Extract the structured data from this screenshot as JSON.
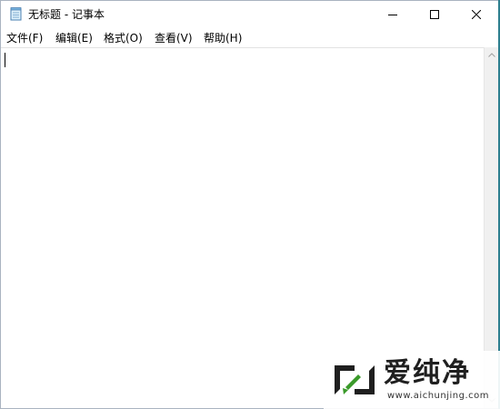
{
  "window": {
    "title": "无标题 - 记事本"
  },
  "title_controls": {
    "minimize_icon": "minimize-icon",
    "maximize_icon": "maximize-icon",
    "close_icon": "close-icon"
  },
  "menu": {
    "items": [
      {
        "label": "文件(F)"
      },
      {
        "label": "编辑(E)"
      },
      {
        "label": "格式(O)"
      },
      {
        "label": "查看(V)"
      },
      {
        "label": "帮助(H)"
      }
    ]
  },
  "editor": {
    "content": ""
  },
  "watermark": {
    "text": "爱纯净",
    "url": "www.aichunjing.com",
    "color": "#3a9a2a"
  },
  "colors": {
    "desktop_edge": "#2d7f8f",
    "window_border": "#a9b3c0",
    "scrollbar_bg": "#f0f0f0"
  }
}
